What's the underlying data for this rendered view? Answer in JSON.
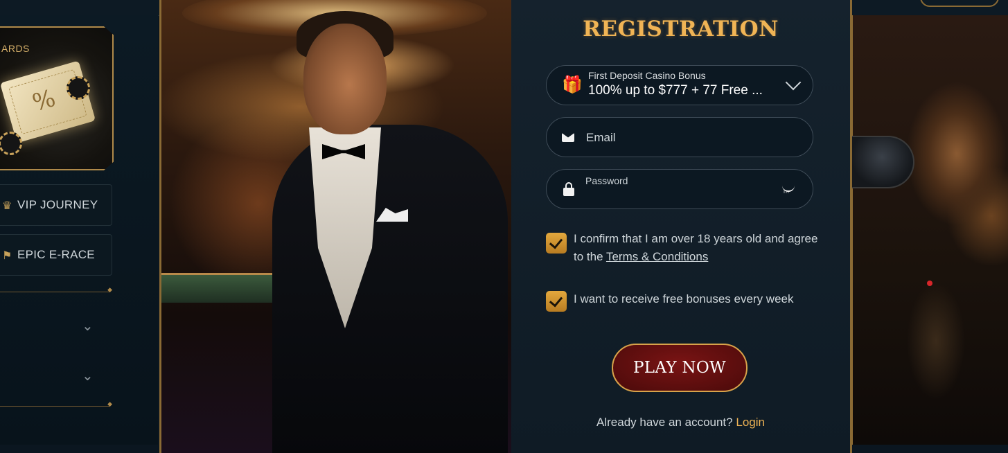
{
  "sidebar": {
    "rewards_label": "ARDS",
    "rewards_pct": "%",
    "items": [
      {
        "label": "VIP JOURNEY",
        "icon": "crown-icon"
      },
      {
        "label": "EPIC E-RACE",
        "icon": "flag-icon"
      }
    ]
  },
  "modal": {
    "title": "REGISTRATION",
    "bonus": {
      "caption": "First Deposit Casino Bonus",
      "value": "100% up to $777 + 77 Free ...",
      "icon": "gift-icon"
    },
    "email": {
      "placeholder": "Email",
      "icon": "envelope-icon"
    },
    "password": {
      "label": "Password",
      "icon": "lock-icon",
      "toggle_icon": "eye-closed-icon"
    },
    "age_confirm": {
      "text": "I confirm that I am over 18 years old and agree to the ",
      "link": "Terms & Conditions",
      "checked": true
    },
    "bonus_optin": {
      "text": "I want to receive free bonuses every week",
      "checked": true
    },
    "play_button": "PLAY NOW",
    "login_prompt": "Already have an account?",
    "login_link": "Login"
  },
  "colors": {
    "accent_gold": "#f0b455",
    "button_red": "#6a1010",
    "panel_bg": "#15222d"
  }
}
